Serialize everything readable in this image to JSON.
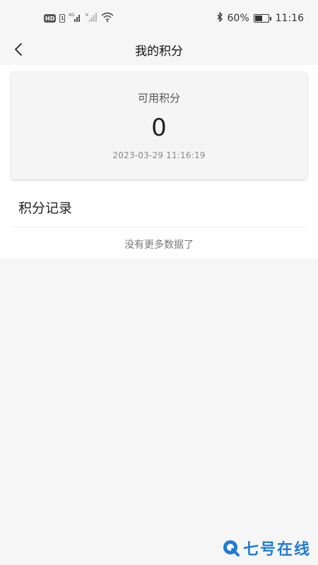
{
  "status_bar": {
    "hd_label": "HD",
    "sim_label": "1",
    "network_label": "4G",
    "battery_percent": "60%",
    "battery_level": 0.6,
    "time": "11:16"
  },
  "header": {
    "title": "我的积分"
  },
  "points_card": {
    "label": "可用积分",
    "value": "0",
    "timestamp": "2023-03-29 11:16:19"
  },
  "records": {
    "title": "积分记录",
    "empty_text": "没有更多数据了"
  },
  "watermark": {
    "text": "七号在线",
    "color": "#1f7cd6"
  },
  "colors": {
    "page_bg": "#f6f6f6",
    "card_bg": "#f5f5f5"
  }
}
